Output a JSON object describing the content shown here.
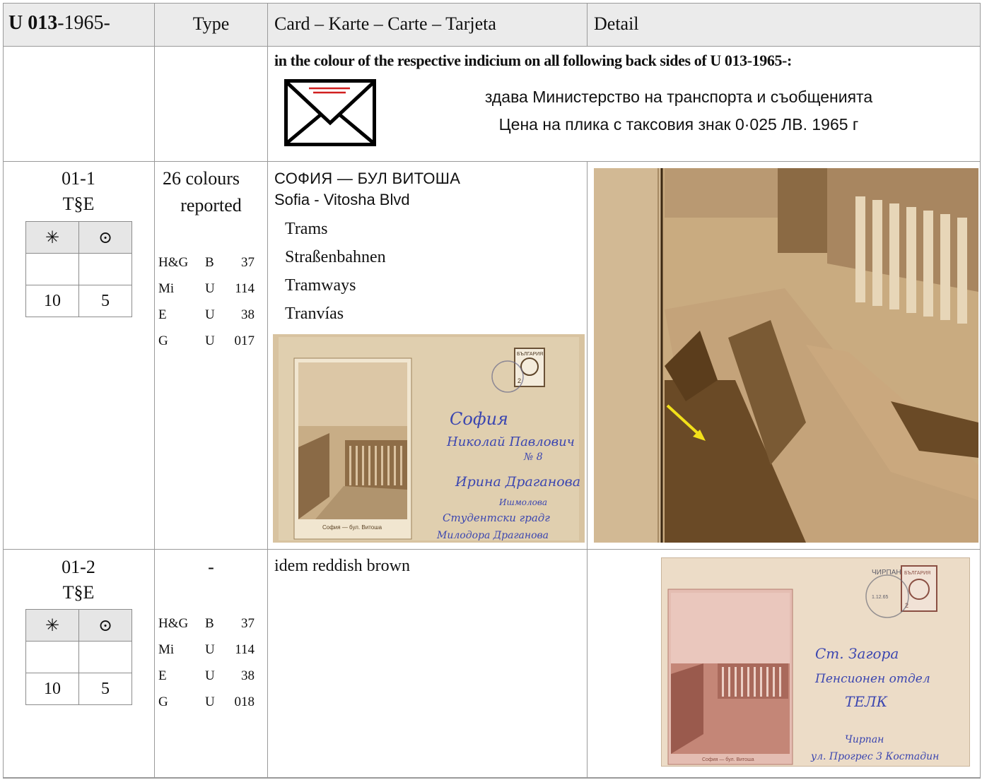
{
  "header": {
    "id_bold": "U 013",
    "id_rest": "-1965-",
    "type": "Type",
    "card": "Card – Karte – Carte – Tarjeta",
    "detail": "Detail"
  },
  "note": {
    "title": "in the colour of the respective indicium on all following back sides of U 013-1965-:",
    "line1": "здава Министерство на транспорта и съобщенията",
    "line2": "Цена на плика с таксовия знак 0·025 ЛВ. 1965 г"
  },
  "rows": [
    {
      "number": "01-1",
      "code": "T§E",
      "symbols": {
        "mint": "✳",
        "used": "⊙"
      },
      "prices": {
        "mint_blank": "",
        "used_blank": "",
        "mint": "10",
        "used": "5"
      },
      "type_line1": "26 colours",
      "type_line2": "reported",
      "catalogues": [
        {
          "name": "H&G",
          "letter": "B",
          "num": "37"
        },
        {
          "name": "Mi",
          "letter": "U",
          "num": "114"
        },
        {
          "name": "E",
          "letter": "U",
          "num": "38"
        },
        {
          "name": "G",
          "letter": "U",
          "num": "017"
        }
      ],
      "desc_bg": "СОФИЯ — БУЛ ВИТОША",
      "desc_en": "Sofia - Vitosha Blvd",
      "languages": [
        "Trams",
        "Straßenbahnen",
        "Tramways",
        "Tranvías"
      ],
      "envelope": {
        "stamp_country": "БЪЛГАРИЯ",
        "stamp_value": "2",
        "caption": "София — бул. Витоша",
        "h_city": "София",
        "h_street": "Николай Павлович",
        "h_num": "№ 8",
        "h_recipient": "Ирина Драганова",
        "h_sender1": "Ишмолова",
        "h_sender2": "Студентски градг",
        "h_sender3": "Милодора Драганова"
      }
    },
    {
      "number": "01-2",
      "code": "T§E",
      "symbols": {
        "mint": "✳",
        "used": "⊙"
      },
      "prices": {
        "mint_blank": "",
        "used_blank": "",
        "mint": "10",
        "used": "5"
      },
      "type_line1": "-",
      "catalogues": [
        {
          "name": "H&G",
          "letter": "B",
          "num": "37"
        },
        {
          "name": "Mi",
          "letter": "U",
          "num": "114"
        },
        {
          "name": "E",
          "letter": "U",
          "num": "38"
        },
        {
          "name": "G",
          "letter": "U",
          "num": "018"
        }
      ],
      "desc": "idem reddish brown",
      "envelope": {
        "stamp_country": "БЪЛГАРИЯ",
        "stamp_value": "2",
        "postmark": "ЧИРПАН",
        "postmark_date": "1.12.65",
        "caption": "София — бул. Витоша",
        "h_city": "Ст. Загора",
        "h_street": "Пенсионен отдел",
        "h_recipient": "ТЕЛК",
        "h_sender1": "Чирпан",
        "h_sender2": "ул. Прогрес 3 Костадин"
      }
    }
  ],
  "colors": {
    "header_bg": "#ebebeb",
    "grid": "#9a9a9a",
    "sepia_light": "#d9c5a2",
    "sepia_dark": "#7a5a34",
    "reddish": "#b86f62",
    "ink_blue": "#3b46b0",
    "arrow": "#f2e01a",
    "envelope_accent": "#d11f1f"
  },
  "icons": [
    "envelope-icon",
    "asterisk-icon",
    "circled-dot-icon",
    "yellow-arrow-icon"
  ]
}
